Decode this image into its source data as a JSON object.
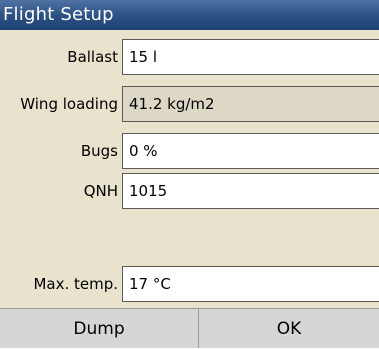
{
  "dialog": {
    "title": "Flight Setup"
  },
  "fields": {
    "ballast": {
      "label": "Ballast",
      "value": "15 l"
    },
    "wing_loading": {
      "label": "Wing loading",
      "value": "41.2 kg/m2"
    },
    "bugs": {
      "label": "Bugs",
      "value": "0 %"
    },
    "qnh": {
      "label": "QNH",
      "value": "1015"
    },
    "max_temp": {
      "label": "Max. temp.",
      "value": "17 °C"
    }
  },
  "buttons": {
    "dump": "Dump",
    "ok": "OK"
  },
  "colors": {
    "title_bar": "#2b4f82",
    "dialog_background": "#e9e2cc",
    "readonly_field": "#ddd7c6",
    "button_background": "#d6d6d6"
  }
}
